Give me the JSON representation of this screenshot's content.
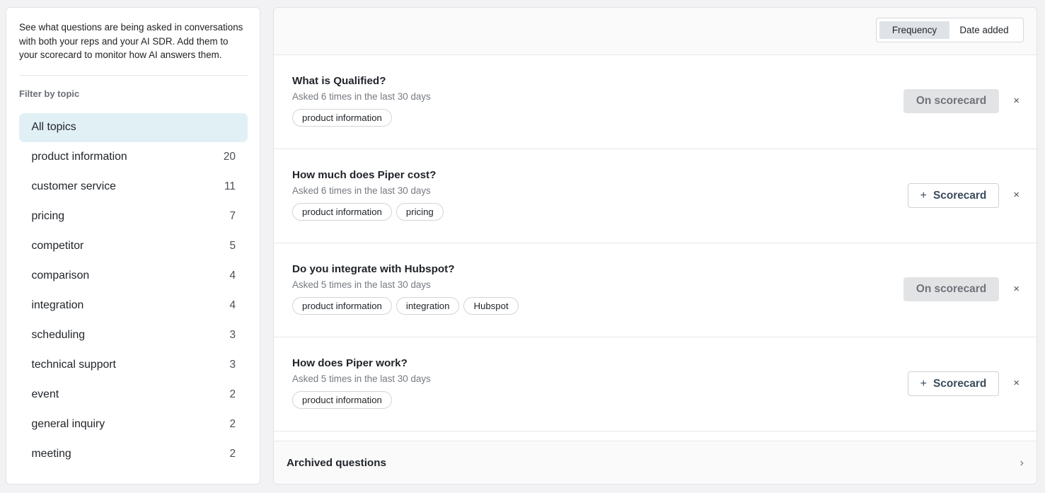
{
  "sidebar": {
    "intro": "See what questions are being asked in conversations with both your reps and your AI SDR. Add them to your scorecard to monitor how AI answers them.",
    "filter_heading": "Filter by topic",
    "topics": [
      {
        "label": "All topics",
        "count": ""
      },
      {
        "label": "product information",
        "count": "20"
      },
      {
        "label": "customer service",
        "count": "11"
      },
      {
        "label": "pricing",
        "count": "7"
      },
      {
        "label": "competitor",
        "count": "5"
      },
      {
        "label": "comparison",
        "count": "4"
      },
      {
        "label": "integration",
        "count": "4"
      },
      {
        "label": "scheduling",
        "count": "3"
      },
      {
        "label": "technical support",
        "count": "3"
      },
      {
        "label": "event",
        "count": "2"
      },
      {
        "label": "general inquiry",
        "count": "2"
      },
      {
        "label": "meeting",
        "count": "2"
      }
    ]
  },
  "sort": {
    "frequency": "Frequency",
    "date_added": "Date added"
  },
  "questions": [
    {
      "title": "What is Qualified?",
      "meta": "Asked 6 times in the last 30 days",
      "tags": [
        "product information"
      ],
      "status": "On scorecard",
      "dismiss": "×"
    },
    {
      "title": "How much does Piper cost?",
      "meta": "Asked 6 times in the last 30 days",
      "tags": [
        "product information",
        "pricing"
      ],
      "status": "Scorecard",
      "plus": "+",
      "dismiss": "×"
    },
    {
      "title": "Do you integrate with Hubspot?",
      "meta": "Asked 5 times in the last 30 days",
      "tags": [
        "product information",
        "integration",
        "Hubspot"
      ],
      "status": "On scorecard",
      "dismiss": "×"
    },
    {
      "title": "How does Piper work?",
      "meta": "Asked 5 times in the last 30 days",
      "tags": [
        "product information"
      ],
      "status": "Scorecard",
      "plus": "+",
      "dismiss": "×"
    }
  ],
  "archived": {
    "label": "Archived questions",
    "chevron": "›"
  },
  "colors": {
    "active_topic_bg": "#e1f0f5",
    "on_scorecard_bg": "#e2e3e5"
  }
}
